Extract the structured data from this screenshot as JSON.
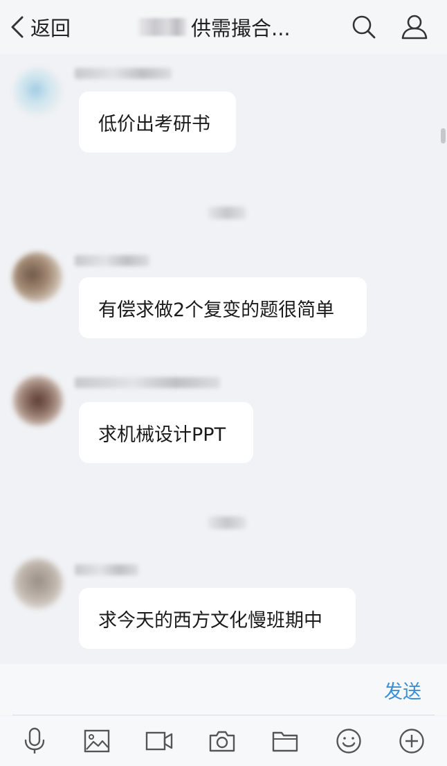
{
  "header": {
    "back_label": "返回",
    "title": "供需撮合..."
  },
  "messages": [
    {
      "text": "低价出考研书"
    },
    {
      "text": "有偿求做2个复变的题很简单"
    },
    {
      "text": "求机械设计PPT"
    },
    {
      "text": "求今天的西方文化慢班期中"
    }
  ],
  "input": {
    "send_label": "发送"
  },
  "colors": {
    "accent": "#3a8ed6",
    "background": "#f1f2f5",
    "bubble": "#ffffff"
  },
  "icons": {
    "back": "chevron-left-icon",
    "search": "search-icon",
    "group": "person-icon",
    "toolbar": [
      "microphone-icon",
      "image-icon",
      "video-icon",
      "camera-icon",
      "folder-icon",
      "emoji-icon",
      "plus-circle-icon"
    ]
  }
}
